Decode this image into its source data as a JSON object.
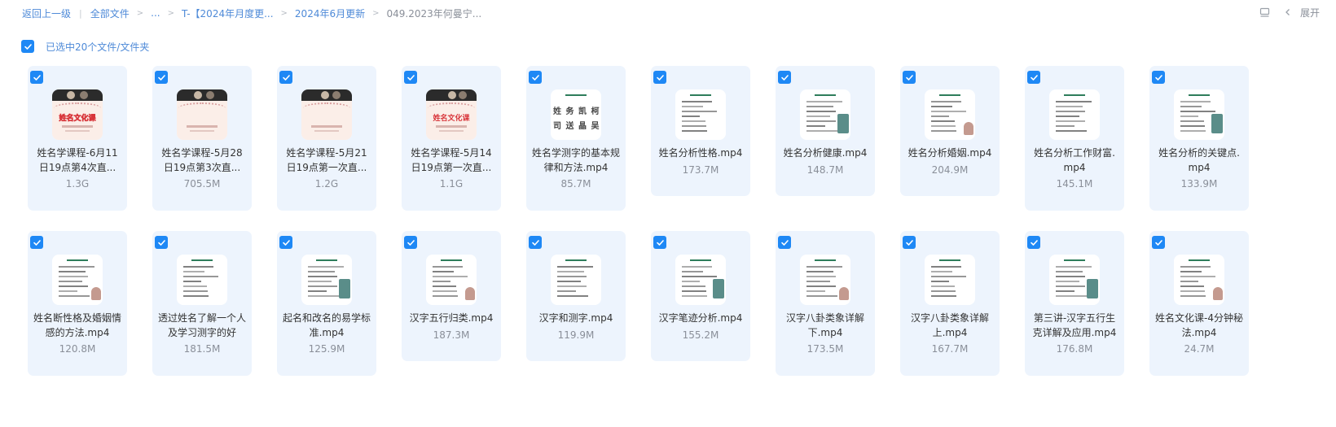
{
  "breadcrumb": {
    "back": "返回上一级",
    "all_files": "全部文件",
    "ellipsis": "...",
    "folder_1": "T-【2024年月度更...",
    "folder_2": "2024年6月更新",
    "current": "049.2023年何曼宁..."
  },
  "toolbar": {
    "expand_label": "展开"
  },
  "selection": {
    "summary": "已选中20个文件/文件夹"
  },
  "files": [
    {
      "name": "姓名学课程-6月11日19点第4次直...",
      "size": "1.3G",
      "thumb": "course",
      "thumb_text": "姓名文化课",
      "checked": true
    },
    {
      "name": "姓名学课程-5月28日19点第3次直...",
      "size": "705.5M",
      "thumb": "course",
      "thumb_text": "",
      "checked": true
    },
    {
      "name": "姓名学课程-5月21日19点第一次直...",
      "size": "1.2G",
      "thumb": "course",
      "thumb_text": "",
      "checked": true
    },
    {
      "name": "姓名学课程-5月14日19点第一次直...",
      "size": "1.1G",
      "thumb": "course",
      "thumb_text": "姓名文化课",
      "checked": true
    },
    {
      "name": "姓名学测字的基本规律和方法.mp4",
      "size": "85.7M",
      "thumb": "big",
      "thumb_text": "",
      "checked": true
    },
    {
      "name": "姓名分析性格.mp4",
      "size": "173.7M",
      "thumb": "doc",
      "thumb_text": "",
      "checked": true
    },
    {
      "name": "姓名分析健康.mp4",
      "size": "148.7M",
      "thumb": "doc",
      "thumb_text": "",
      "checked": true
    },
    {
      "name": "姓名分析婚姻.mp4",
      "size": "204.9M",
      "thumb": "doc",
      "thumb_text": "",
      "checked": true
    },
    {
      "name": "姓名分析工作财富.mp4",
      "size": "145.1M",
      "thumb": "doc",
      "thumb_text": "",
      "checked": true
    },
    {
      "name": "姓名分析的关键点.mp4",
      "size": "133.9M",
      "thumb": "doc",
      "thumb_text": "",
      "checked": true
    },
    {
      "name": "姓名断性格及婚姻情感的方法.mp4",
      "size": "120.8M",
      "thumb": "doc",
      "thumb_text": "",
      "checked": true
    },
    {
      "name": "透过姓名了解一个人及学习测字的好",
      "size": "181.5M",
      "thumb": "doc",
      "thumb_text": "",
      "checked": true
    },
    {
      "name": "起名和改名的易学标准.mp4",
      "size": "125.9M",
      "thumb": "doc",
      "thumb_text": "",
      "checked": true
    },
    {
      "name": "汉字五行归类.mp4",
      "size": "187.3M",
      "thumb": "doc",
      "thumb_text": "",
      "checked": true
    },
    {
      "name": "汉字和测字.mp4",
      "size": "119.9M",
      "thumb": "doc",
      "thumb_text": "",
      "checked": true
    },
    {
      "name": "汉字笔迹分析.mp4",
      "size": "155.2M",
      "thumb": "doc",
      "thumb_text": "",
      "checked": true
    },
    {
      "name": "汉字八卦类象详解下.mp4",
      "size": "173.5M",
      "thumb": "doc",
      "thumb_text": "",
      "checked": true
    },
    {
      "name": "汉字八卦类象详解上.mp4",
      "size": "167.7M",
      "thumb": "doc",
      "thumb_text": "",
      "checked": true
    },
    {
      "name": "第三讲-汉字五行生克详解及应用.mp4",
      "size": "176.8M",
      "thumb": "doc",
      "thumb_text": "",
      "checked": true
    },
    {
      "name": "姓名文化课-4分钟秘法.mp4",
      "size": "24.7M",
      "thumb": "doc",
      "thumb_text": "",
      "checked": true
    }
  ],
  "colors": {
    "accent": "#1e88f5",
    "link": "#4e8ad8",
    "card_bg": "#edf4fd",
    "muted": "#8a8f99"
  },
  "icons": {
    "list_view": "list-view-icon",
    "collapse": "chevron-left-icon",
    "check": "check-icon"
  }
}
